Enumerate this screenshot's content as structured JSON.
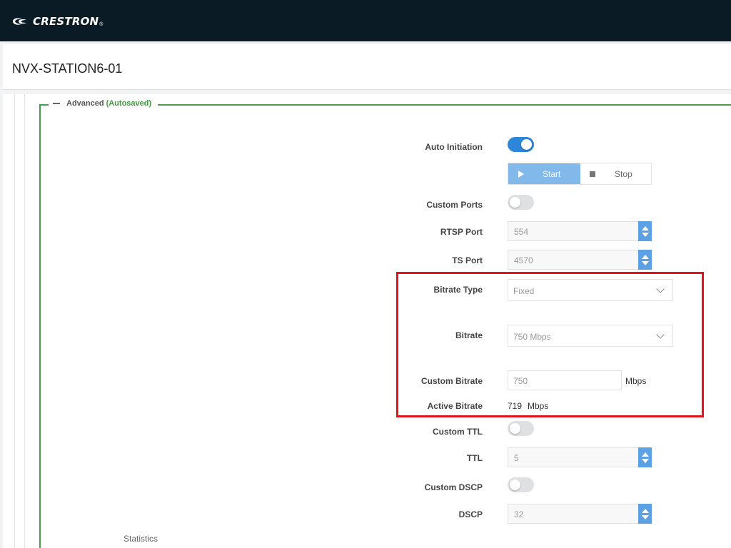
{
  "brand": {
    "name": "CRESTRON",
    "reg": "®"
  },
  "device": {
    "name": "NVX-STATION6-01"
  },
  "advanced": {
    "title": "Advanced",
    "status": "(Autosaved)"
  },
  "fields": {
    "auto_initiation": {
      "label": "Auto Initiation",
      "on": true
    },
    "start_label": "Start",
    "stop_label": "Stop",
    "custom_ports": {
      "label": "Custom Ports",
      "on": false
    },
    "rtsp_port": {
      "label": "RTSP Port",
      "value": "554"
    },
    "ts_port": {
      "label": "TS Port",
      "value": "4570"
    },
    "bitrate_type": {
      "label": "Bitrate Type",
      "value": "Fixed"
    },
    "bitrate": {
      "label": "Bitrate",
      "value": "750 Mbps"
    },
    "custom_bitrate": {
      "label": "Custom Bitrate",
      "value": "750",
      "unit": "Mbps"
    },
    "active_bitrate": {
      "label": "Active Bitrate",
      "value": "719",
      "unit": "Mbps"
    },
    "custom_ttl": {
      "label": "Custom TTL",
      "on": false
    },
    "ttl": {
      "label": "TTL",
      "value": "5"
    },
    "custom_dscp": {
      "label": "Custom DSCP",
      "on": false
    },
    "dscp": {
      "label": "DSCP",
      "value": "32"
    }
  },
  "statistics": {
    "label": "Statistics"
  },
  "colors": {
    "accent": "#2e86d9",
    "highlight": "#e0151b",
    "section": "#47a047"
  }
}
